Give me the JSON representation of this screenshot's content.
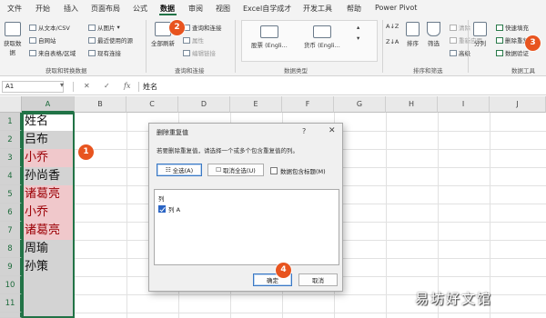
{
  "menu": {
    "tabs": [
      "文件",
      "开始",
      "插入",
      "页面布局",
      "公式",
      "数据",
      "审阅",
      "视图",
      "Excel自学成才",
      "开发工具",
      "帮助",
      "Power Pivot"
    ],
    "active_tab": "数据"
  },
  "ribbon": {
    "get_data": {
      "big_label_1": "获取数",
      "big_label_2": "据",
      "from_text": "从文本/CSV",
      "from_web": "自网站",
      "from_table": "来自表格/区域",
      "from_picture": "从图片",
      "recent_sources": "最近使用的源",
      "existing_connections": "现有连接",
      "group_label": "获取和转换数据"
    },
    "queries": {
      "refresh_all_1": "全部刷新",
      "queries_connections": "查询和连接",
      "properties": "属性",
      "edit_links": "编辑链接",
      "group_label": "查询和连接"
    },
    "data_types": {
      "stocks": "股票 (Engli...",
      "currencies": "货币 (Engli...",
      "group_label": "数据类型"
    },
    "sort_filter": {
      "sort_az": "A↓Z",
      "sort_za": "Z↓A",
      "sort": "排序",
      "filter": "筛选",
      "clear": "清除",
      "reapply": "重新应用",
      "advanced": "高级",
      "group_label": "排序和筛选"
    },
    "data_tools": {
      "text_to_columns": "分列",
      "flash_fill": "快速填充",
      "remove_duplicates": "删除重复值",
      "data_validation": "数据验证",
      "group_label": "数据工具"
    }
  },
  "formula_bar": {
    "name_box": "A1",
    "cancel_glyph": "✕",
    "enter_glyph": "✓",
    "fx_glyph": "fx",
    "content": "姓名"
  },
  "sheet": {
    "columns": [
      "A",
      "B",
      "C",
      "D",
      "E",
      "F",
      "G",
      "H",
      "I",
      "J"
    ],
    "rows": [
      "1",
      "2",
      "3",
      "4",
      "5",
      "6",
      "7",
      "8",
      "9",
      "10",
      "11",
      "12"
    ],
    "column_a": [
      {
        "value": "姓名",
        "style": "first"
      },
      {
        "value": "吕布",
        "style": "plain"
      },
      {
        "value": "小乔",
        "style": "dup"
      },
      {
        "value": "孙尚香",
        "style": "plain"
      },
      {
        "value": "诸葛亮",
        "style": "dup"
      },
      {
        "value": "小乔",
        "style": "dup"
      },
      {
        "value": "诸葛亮",
        "style": "dup"
      },
      {
        "value": "周瑜",
        "style": "plain"
      },
      {
        "value": "孙策",
        "style": "plain"
      }
    ]
  },
  "dialog": {
    "title": "删除重复值",
    "help": "?",
    "close": "✕",
    "description": "若要删除重复值，请选择一个或多个包含重复值的列。",
    "select_all": "全选(A)",
    "unselect_all": "取消全选(U)",
    "has_headers": "数据包含标题(M)",
    "list_header": "列",
    "columns": [
      {
        "label": "列 A",
        "checked": true
      }
    ],
    "ok": "确定",
    "cancel": "取消"
  },
  "steps": [
    "1",
    "2",
    "3",
    "4"
  ],
  "watermark": "易坊好文馆",
  "colors": {
    "excel_green": "#217346",
    "duplicate_fill": "#f0c8cb",
    "duplicate_text": "#9c0006",
    "step_badge": "#e8541f"
  }
}
